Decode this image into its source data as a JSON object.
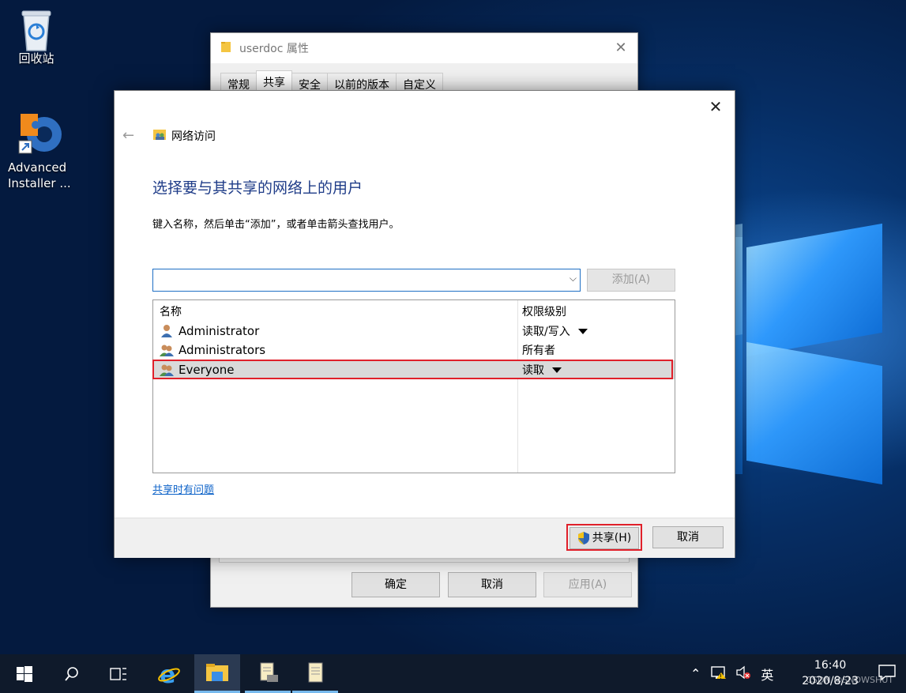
{
  "desktop": {
    "icons": [
      {
        "label": "回收站"
      },
      {
        "label": "Advanced Installer ..."
      }
    ]
  },
  "properties_window": {
    "title": "userdoc 属性",
    "tabs": [
      "常规",
      "共享",
      "安全",
      "以前的版本",
      "自定义"
    ],
    "active_tab": "共享",
    "buttons": {
      "ok": "确定",
      "cancel": "取消",
      "apply": "应用(A)"
    }
  },
  "share_dialog": {
    "breadcrumb": "网络访问",
    "heading": "选择要与其共享的网络上的用户",
    "instruction": "键入名称，然后单击“添加”，或者单击箭头查找用户。",
    "name_input": {
      "value": "",
      "placeholder": ""
    },
    "add_button": "添加(A)",
    "columns": [
      "名称",
      "权限级别"
    ],
    "users": [
      {
        "name": "Administrator",
        "permission": "读取/写入",
        "has_dropdown": true,
        "icon": "user-icon"
      },
      {
        "name": "Administrators",
        "permission": "所有者",
        "has_dropdown": false,
        "icon": "group-icon"
      },
      {
        "name": "Everyone",
        "permission": "读取",
        "has_dropdown": true,
        "icon": "group-icon",
        "selected": true
      }
    ],
    "help_link": "共享时有问题",
    "share_button": "共享(H)",
    "cancel_button": "取消"
  },
  "taskbar": {
    "ime": "英",
    "time": "16:40",
    "date": "2020/8/23",
    "watermark": "CSDN @SNOWSHUT"
  },
  "colors": {
    "accent": "#1f6fc4",
    "heading": "#1f3c88",
    "link": "#0c62c8",
    "highlight_border": "#e0202a",
    "taskbar": "#0f1a2b"
  }
}
